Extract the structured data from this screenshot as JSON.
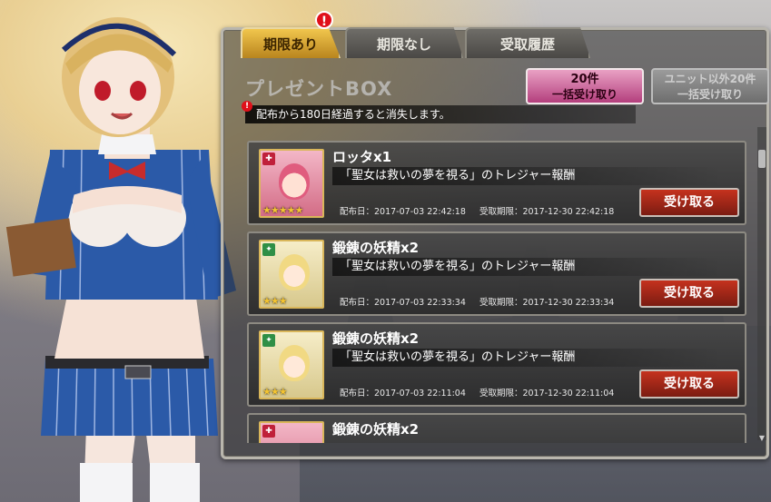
{
  "tabs": [
    {
      "label": "期限あり"
    },
    {
      "label": "期限なし"
    },
    {
      "label": "受取履歴"
    }
  ],
  "notify_badge": "!",
  "box_title": "プレゼントBOX",
  "bulk_buttons": {
    "primary": {
      "line1": "20件",
      "line2": "一括受け取り"
    },
    "secondary": {
      "line1": "ユニット以外20件",
      "line2": "一括受け取り"
    }
  },
  "notice": "配布から180日経過すると消失します。",
  "items": [
    {
      "name": "ロッタx1",
      "desc": "「聖女は救いの夢を視る」のトレジャー報酬",
      "dist_date": "配布日：2017-07-03 22:42:18",
      "deadline": "受取期限：2017-12-30 22:42:18",
      "button": "受け取る",
      "stars": "★★★★★"
    },
    {
      "name": "鍛錬の妖精x2",
      "desc": "「聖女は救いの夢を視る」のトレジャー報酬",
      "dist_date": "配布日：2017-07-03 22:33:34",
      "deadline": "受取期限：2017-12-30 22:33:34",
      "button": "受け取る",
      "stars": "★★★"
    },
    {
      "name": "鍛錬の妖精x2",
      "desc": "「聖女は救いの夢を視る」のトレジャー報酬",
      "dist_date": "配布日：2017-07-03 22:11:04",
      "deadline": "受取期限：2017-12-30 22:11:04",
      "button": "受け取る",
      "stars": "★★★"
    },
    {
      "name": "鍛錬の妖精x2"
    }
  ]
}
